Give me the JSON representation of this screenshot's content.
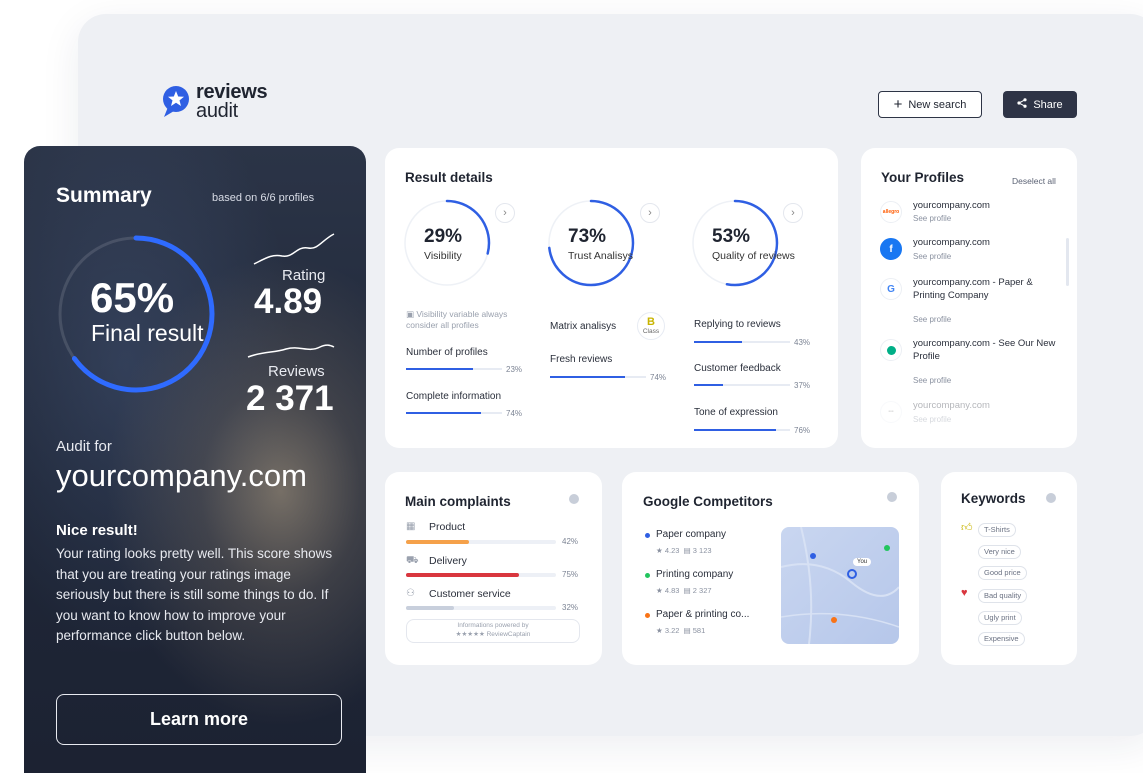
{
  "brand": {
    "name_line1": "reviews",
    "name_line2": "audit"
  },
  "header": {
    "new_search_label": "New search",
    "share_label": "Share"
  },
  "summary": {
    "title": "Summary",
    "based_on": "based on 6/6 profiles",
    "final_percent": "65%",
    "final_value": 0.65,
    "final_label": "Final result",
    "rating_label": "Rating",
    "rating_value": "4.89",
    "reviews_label": "Reviews",
    "reviews_value": "2 371",
    "audit_for_label": "Audit for",
    "domain": "yourcompany.com",
    "headline": "Nice result!",
    "body": "Your rating looks pretty well. This score shows that you are treating your ratings image seriously but there is still some things to do. If you want to know how to improve your performance click button below.",
    "cta_label": "Learn more"
  },
  "result_details": {
    "title": "Result details",
    "gauges": [
      {
        "percent": "29%",
        "value": 0.29,
        "label": "Visibility"
      },
      {
        "percent": "73%",
        "value": 0.73,
        "label": "Trust Analisys"
      },
      {
        "percent": "53%",
        "value": 0.53,
        "label": "Quality of reviews"
      }
    ],
    "visibility_note_l1": "Visibility variable always",
    "visibility_note_l2": "consider all profiles",
    "visibility_metrics": [
      {
        "label": "Number of profiles",
        "value": "23%",
        "fill": 0.7
      },
      {
        "label": "Complete information",
        "value": "74%",
        "fill": 0.78
      }
    ],
    "trust_metrics": [
      {
        "label": "Matrix analisys"
      },
      {
        "label": "Fresh reviews",
        "value": "74%",
        "fill": 0.78
      }
    ],
    "class_badge": {
      "grade": "B",
      "label": "Class"
    },
    "quality_metrics": [
      {
        "label": "Replying to reviews",
        "value": "43%",
        "fill": 0.5
      },
      {
        "label": "Customer feedback",
        "value": "37%",
        "fill": 0.3
      },
      {
        "label": "Tone of expression",
        "value": "76%",
        "fill": 0.85
      }
    ]
  },
  "profiles": {
    "title": "Your Profiles",
    "deselect_label": "Deselect all",
    "items": [
      {
        "icon": "allegro-icon",
        "name": "yourcompany.com",
        "see": "See profile",
        "color": "#ff5a00"
      },
      {
        "icon": "facebook-icon",
        "name": "yourcompany.com",
        "see": "See profile",
        "color": "#1877f2"
      },
      {
        "icon": "google-icon",
        "name": "yourcompany.com - Paper & Printing Company",
        "see": "See profile",
        "color": "#4285f4"
      },
      {
        "icon": "tripadvisor-icon",
        "name": "yourcompany.com - See Our New Profile",
        "see": "See profile",
        "color": "#00af87"
      },
      {
        "icon": "profile-icon",
        "name": "yourcompany.com",
        "see": "See profile",
        "color": "#c0c4cc"
      }
    ]
  },
  "complaints": {
    "title": "Main complaints",
    "items": [
      {
        "label": "Product",
        "value": "42%",
        "fill": 0.42,
        "color": "#f5a14a"
      },
      {
        "label": "Delivery",
        "value": "75%",
        "fill": 0.75,
        "color": "#d9363e"
      },
      {
        "label": "Customer service",
        "value": "32%",
        "fill": 0.32,
        "color": "#c8cfdc"
      }
    ],
    "powered_l1": "Informations powered by",
    "powered_l2": "★★★★★ ReviewCaptain"
  },
  "competitors": {
    "title": "Google Competitors",
    "items": [
      {
        "name": "Paper company",
        "rating": "4.23",
        "reviews": "3 123",
        "color": "#2f5fe3"
      },
      {
        "name": "Printing company",
        "rating": "4.83",
        "reviews": "2 327",
        "color": "#22c55e"
      },
      {
        "name": "Paper & printing co...",
        "rating": "3.22",
        "reviews": "581",
        "color": "#f97316"
      }
    ],
    "map_pin_label": "You"
  },
  "keywords": {
    "title": "Keywords",
    "positive": [
      "T-Shirts",
      "Very nice",
      "Good price"
    ],
    "negative": [
      "Bad quality",
      "Ugly print",
      "Expensive"
    ]
  }
}
